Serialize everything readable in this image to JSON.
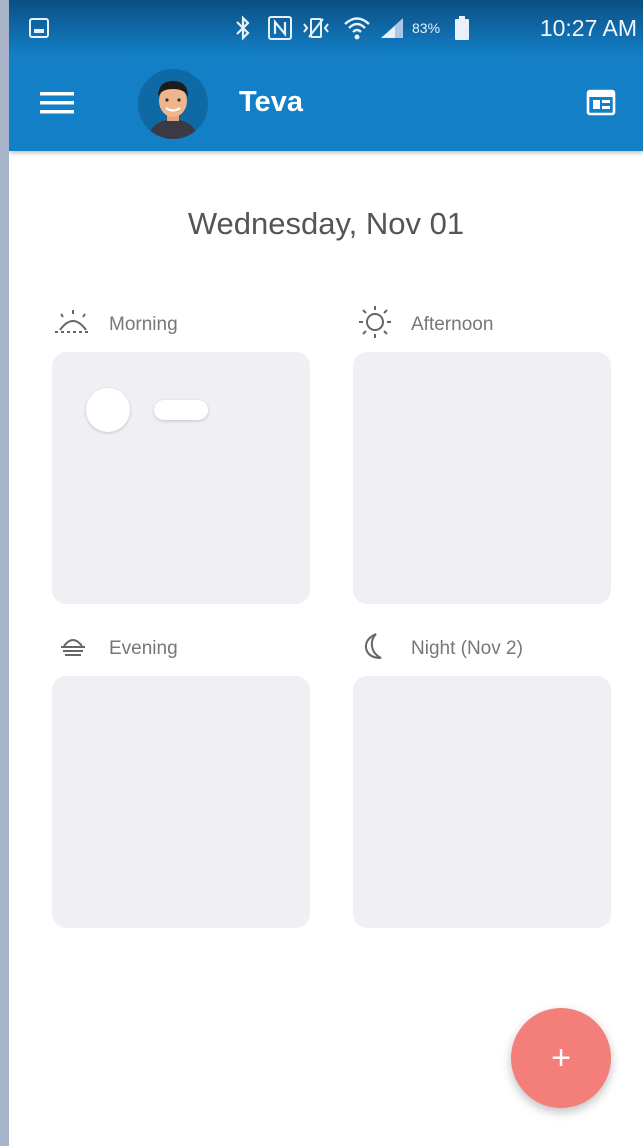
{
  "status_bar": {
    "battery": "83%",
    "time": "10:27 AM",
    "icons": [
      "gallery-notification-icon",
      "bluetooth-icon",
      "nfc-icon",
      "vibrate-icon",
      "wifi-icon",
      "signal-icon",
      "battery-icon"
    ]
  },
  "app_bar": {
    "title": "Teva",
    "menu_icon": "hamburger-menu-icon",
    "action_icon": "calendar-icon",
    "color": "#137fc6"
  },
  "schedule": {
    "date": "Wednesday, Nov 01",
    "slots": [
      {
        "label": "Morning",
        "icon": "sunrise-icon",
        "loading": true
      },
      {
        "label": "Afternoon",
        "icon": "sun-icon",
        "loading": false
      },
      {
        "label": "Evening",
        "icon": "sunset-icon",
        "loading": false
      },
      {
        "label": "Night (Nov 2)",
        "icon": "moon-icon",
        "loading": false
      }
    ]
  },
  "fab": {
    "label": "+",
    "color": "#f47e79"
  }
}
